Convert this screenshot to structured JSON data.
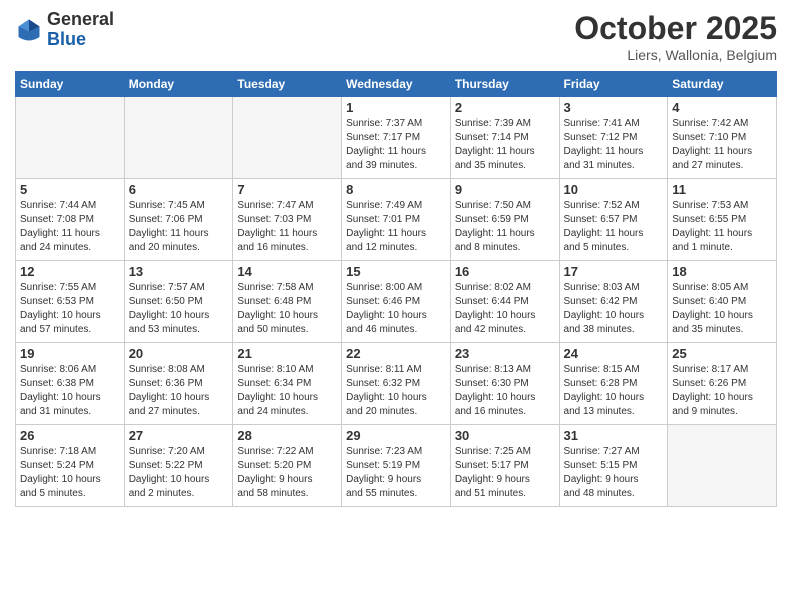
{
  "header": {
    "logo_general": "General",
    "logo_blue": "Blue",
    "month_title": "October 2025",
    "location": "Liers, Wallonia, Belgium"
  },
  "days_of_week": [
    "Sunday",
    "Monday",
    "Tuesday",
    "Wednesday",
    "Thursday",
    "Friday",
    "Saturday"
  ],
  "weeks": [
    [
      {
        "num": "",
        "info": ""
      },
      {
        "num": "",
        "info": ""
      },
      {
        "num": "",
        "info": ""
      },
      {
        "num": "1",
        "info": "Sunrise: 7:37 AM\nSunset: 7:17 PM\nDaylight: 11 hours\nand 39 minutes."
      },
      {
        "num": "2",
        "info": "Sunrise: 7:39 AM\nSunset: 7:14 PM\nDaylight: 11 hours\nand 35 minutes."
      },
      {
        "num": "3",
        "info": "Sunrise: 7:41 AM\nSunset: 7:12 PM\nDaylight: 11 hours\nand 31 minutes."
      },
      {
        "num": "4",
        "info": "Sunrise: 7:42 AM\nSunset: 7:10 PM\nDaylight: 11 hours\nand 27 minutes."
      }
    ],
    [
      {
        "num": "5",
        "info": "Sunrise: 7:44 AM\nSunset: 7:08 PM\nDaylight: 11 hours\nand 24 minutes."
      },
      {
        "num": "6",
        "info": "Sunrise: 7:45 AM\nSunset: 7:06 PM\nDaylight: 11 hours\nand 20 minutes."
      },
      {
        "num": "7",
        "info": "Sunrise: 7:47 AM\nSunset: 7:03 PM\nDaylight: 11 hours\nand 16 minutes."
      },
      {
        "num": "8",
        "info": "Sunrise: 7:49 AM\nSunset: 7:01 PM\nDaylight: 11 hours\nand 12 minutes."
      },
      {
        "num": "9",
        "info": "Sunrise: 7:50 AM\nSunset: 6:59 PM\nDaylight: 11 hours\nand 8 minutes."
      },
      {
        "num": "10",
        "info": "Sunrise: 7:52 AM\nSunset: 6:57 PM\nDaylight: 11 hours\nand 5 minutes."
      },
      {
        "num": "11",
        "info": "Sunrise: 7:53 AM\nSunset: 6:55 PM\nDaylight: 11 hours\nand 1 minute."
      }
    ],
    [
      {
        "num": "12",
        "info": "Sunrise: 7:55 AM\nSunset: 6:53 PM\nDaylight: 10 hours\nand 57 minutes."
      },
      {
        "num": "13",
        "info": "Sunrise: 7:57 AM\nSunset: 6:50 PM\nDaylight: 10 hours\nand 53 minutes."
      },
      {
        "num": "14",
        "info": "Sunrise: 7:58 AM\nSunset: 6:48 PM\nDaylight: 10 hours\nand 50 minutes."
      },
      {
        "num": "15",
        "info": "Sunrise: 8:00 AM\nSunset: 6:46 PM\nDaylight: 10 hours\nand 46 minutes."
      },
      {
        "num": "16",
        "info": "Sunrise: 8:02 AM\nSunset: 6:44 PM\nDaylight: 10 hours\nand 42 minutes."
      },
      {
        "num": "17",
        "info": "Sunrise: 8:03 AM\nSunset: 6:42 PM\nDaylight: 10 hours\nand 38 minutes."
      },
      {
        "num": "18",
        "info": "Sunrise: 8:05 AM\nSunset: 6:40 PM\nDaylight: 10 hours\nand 35 minutes."
      }
    ],
    [
      {
        "num": "19",
        "info": "Sunrise: 8:06 AM\nSunset: 6:38 PM\nDaylight: 10 hours\nand 31 minutes."
      },
      {
        "num": "20",
        "info": "Sunrise: 8:08 AM\nSunset: 6:36 PM\nDaylight: 10 hours\nand 27 minutes."
      },
      {
        "num": "21",
        "info": "Sunrise: 8:10 AM\nSunset: 6:34 PM\nDaylight: 10 hours\nand 24 minutes."
      },
      {
        "num": "22",
        "info": "Sunrise: 8:11 AM\nSunset: 6:32 PM\nDaylight: 10 hours\nand 20 minutes."
      },
      {
        "num": "23",
        "info": "Sunrise: 8:13 AM\nSunset: 6:30 PM\nDaylight: 10 hours\nand 16 minutes."
      },
      {
        "num": "24",
        "info": "Sunrise: 8:15 AM\nSunset: 6:28 PM\nDaylight: 10 hours\nand 13 minutes."
      },
      {
        "num": "25",
        "info": "Sunrise: 8:17 AM\nSunset: 6:26 PM\nDaylight: 10 hours\nand 9 minutes."
      }
    ],
    [
      {
        "num": "26",
        "info": "Sunrise: 7:18 AM\nSunset: 5:24 PM\nDaylight: 10 hours\nand 5 minutes."
      },
      {
        "num": "27",
        "info": "Sunrise: 7:20 AM\nSunset: 5:22 PM\nDaylight: 10 hours\nand 2 minutes."
      },
      {
        "num": "28",
        "info": "Sunrise: 7:22 AM\nSunset: 5:20 PM\nDaylight: 9 hours\nand 58 minutes."
      },
      {
        "num": "29",
        "info": "Sunrise: 7:23 AM\nSunset: 5:19 PM\nDaylight: 9 hours\nand 55 minutes."
      },
      {
        "num": "30",
        "info": "Sunrise: 7:25 AM\nSunset: 5:17 PM\nDaylight: 9 hours\nand 51 minutes."
      },
      {
        "num": "31",
        "info": "Sunrise: 7:27 AM\nSunset: 5:15 PM\nDaylight: 9 hours\nand 48 minutes."
      },
      {
        "num": "",
        "info": ""
      }
    ]
  ]
}
